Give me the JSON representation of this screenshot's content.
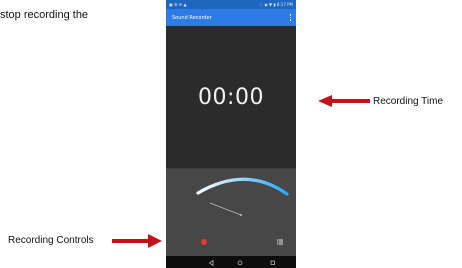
{
  "document": {
    "intro_text": "stop recording the"
  },
  "callouts": {
    "recording_time": "Recording Time",
    "recording_controls": "Recording Controls"
  },
  "phone": {
    "status_bar": {
      "left_icons": "▣ ⚙ ✉ ▲",
      "right_text": "◌ ◉ ▼  ▮ 8:17 PM"
    },
    "app_bar": {
      "title": "Sound Recorder"
    },
    "timer": "00:00",
    "level_meter": {
      "level": 0.0
    }
  },
  "colors": {
    "status_bar": "#1f66c1",
    "app_bar": "#2f7be6",
    "record": "#e53935",
    "arrow": "#c3121a",
    "meter_start": "#ffffff",
    "meter_end": "#2aa8ff"
  }
}
